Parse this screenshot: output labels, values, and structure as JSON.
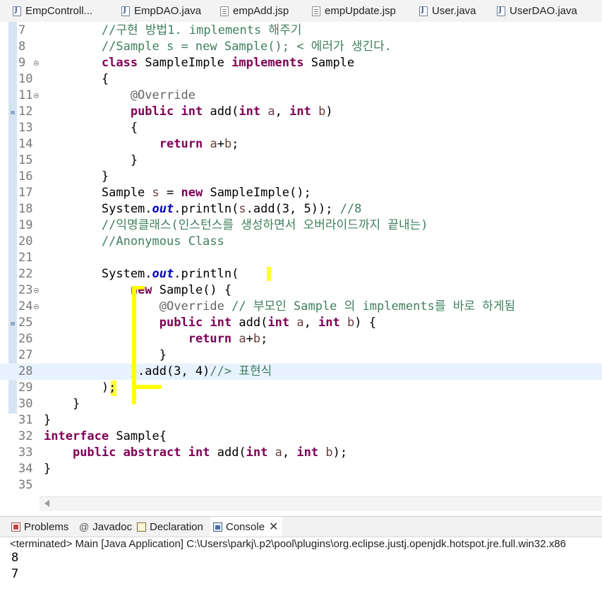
{
  "editor_tabs": [
    {
      "label": "EmpControll...",
      "icon": "java-file-icon"
    },
    {
      "label": "EmpDAO.java",
      "icon": "java-file-icon"
    },
    {
      "label": "empAdd.jsp",
      "icon": "jsp-file-icon"
    },
    {
      "label": "empUpdate.jsp",
      "icon": "jsp-file-icon"
    },
    {
      "label": "User.java",
      "icon": "java-file-icon"
    },
    {
      "label": "UserDAO.java",
      "icon": "java-file-icon"
    }
  ],
  "code_lines": [
    {
      "n": "7",
      "text": "        //구현 방법1. implements 해주기"
    },
    {
      "n": "8",
      "text": "        //Sample s = new Sample(); < 에러가 생긴다."
    },
    {
      "n": "9",
      "text": "        class SampleImple implements Sample"
    },
    {
      "n": "10",
      "text": "        {"
    },
    {
      "n": "11",
      "text": "            @Override"
    },
    {
      "n": "12",
      "text": "            public int add(int a, int b)"
    },
    {
      "n": "13",
      "text": "            {"
    },
    {
      "n": "14",
      "text": "                return a+b;"
    },
    {
      "n": "15",
      "text": "            }"
    },
    {
      "n": "16",
      "text": "        }"
    },
    {
      "n": "17",
      "text": "        Sample s = new SampleImple();"
    },
    {
      "n": "18",
      "text": "        System.out.println(s.add(3, 5)); //8"
    },
    {
      "n": "19",
      "text": "        //익명클래스(인스턴스를 생성하면서 오버라이드까지 끝내는)"
    },
    {
      "n": "20",
      "text": "        //Anonymous Class"
    },
    {
      "n": "21",
      "text": ""
    },
    {
      "n": "22",
      "text": "        System.out.println("
    },
    {
      "n": "23",
      "text": "            new Sample() {"
    },
    {
      "n": "24",
      "text": "                @Override // 부모인 Sample 의 implements를 바로 하게됨"
    },
    {
      "n": "25",
      "text": "                public int add(int a, int b) {"
    },
    {
      "n": "26",
      "text": "                    return a+b;"
    },
    {
      "n": "27",
      "text": "                }"
    },
    {
      "n": "28",
      "text": "            }.add(3, 4)//> 표현식"
    },
    {
      "n": "29",
      "text": "        );"
    },
    {
      "n": "30",
      "text": "    }"
    },
    {
      "n": "31",
      "text": "}"
    },
    {
      "n": "32",
      "text": "interface Sample{"
    },
    {
      "n": "33",
      "text": "    public abstract int add(int a, int b);"
    },
    {
      "n": "34",
      "text": "}"
    },
    {
      "n": "35",
      "text": ""
    }
  ],
  "panel_tabs": [
    {
      "label": "Problems",
      "icon": "problems-icon"
    },
    {
      "label": "Javadoc",
      "icon": "javadoc-icon"
    },
    {
      "label": "Declaration",
      "icon": "declaration-icon"
    },
    {
      "label": "Console",
      "icon": "console-icon",
      "active": true
    }
  ],
  "console": {
    "header": "<terminated> Main [Java Application] C:\\Users\\parkj\\.p2\\pool\\plugins\\org.eclipse.justj.openjdk.hotspot.jre.full.win32.x86",
    "output": [
      "8",
      "7"
    ]
  },
  "colors": {
    "keyword": "#7f0055",
    "comment": "#3f7f5f",
    "field": "#0000c0",
    "highlight": "#ffff00",
    "current_line": "#e8f2fe"
  }
}
